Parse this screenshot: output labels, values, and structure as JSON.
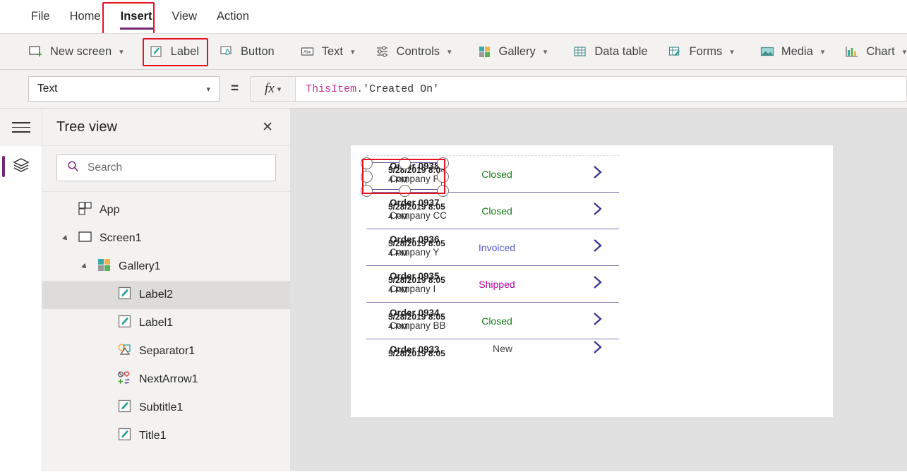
{
  "menu": {
    "items": [
      {
        "label": "File",
        "active": false
      },
      {
        "label": "Home",
        "active": false
      },
      {
        "label": "Insert",
        "active": true
      },
      {
        "label": "View",
        "active": false
      },
      {
        "label": "Action",
        "active": false
      }
    ],
    "highlight_color": "#e81123",
    "active_underline_color": "#742774"
  },
  "ribbon": {
    "items": [
      {
        "label": "New screen",
        "icon": "new-screen-icon",
        "caret": true
      },
      {
        "label": "Label",
        "icon": "label-icon",
        "caret": false
      },
      {
        "label": "Button",
        "icon": "button-icon",
        "caret": false
      },
      {
        "label": "Text",
        "icon": "text-abc-icon",
        "caret": true
      },
      {
        "label": "Controls",
        "icon": "controls-sliders-icon",
        "caret": true
      },
      {
        "label": "Gallery",
        "icon": "gallery-squares-icon",
        "caret": true
      },
      {
        "label": "Data table",
        "icon": "data-table-icon",
        "caret": false
      },
      {
        "label": "Forms",
        "icon": "forms-icon",
        "caret": true
      },
      {
        "label": "Media",
        "icon": "media-image-icon",
        "caret": true
      },
      {
        "label": "Chart",
        "icon": "chart-bars-icon",
        "caret": true
      }
    ]
  },
  "formula_bar": {
    "property": "Text",
    "equals": "=",
    "fx_label": "fx",
    "formula_tokens": [
      {
        "text": "ThisItem",
        "type": "ident"
      },
      {
        "text": ".'Created On'",
        "type": "plain"
      }
    ],
    "formula_full": "ThisItem.'Created On'"
  },
  "tree_panel": {
    "title": "Tree view",
    "close_label": "✕",
    "search_placeholder": "Search",
    "search_value": "",
    "items": [
      {
        "label": "App",
        "indent": 0,
        "icon": "app-icon",
        "twisty": "none",
        "selected": false
      },
      {
        "label": "Screen1",
        "indent": 0,
        "icon": "screen-icon",
        "twisty": "expanded",
        "selected": false
      },
      {
        "label": "Gallery1",
        "indent": 1,
        "icon": "gallery-icon",
        "twisty": "expanded",
        "selected": false
      },
      {
        "label": "Label2",
        "indent": 2,
        "icon": "label-icon",
        "twisty": "none",
        "selected": true
      },
      {
        "label": "Label1",
        "indent": 2,
        "icon": "label-icon",
        "twisty": "none",
        "selected": false
      },
      {
        "label": "Separator1",
        "indent": 2,
        "icon": "separator-icon",
        "twisty": "none",
        "selected": false
      },
      {
        "label": "NextArrow1",
        "indent": 2,
        "icon": "nextarrow-icon",
        "twisty": "none",
        "selected": false
      },
      {
        "label": "Subtitle1",
        "indent": 2,
        "icon": "label-icon",
        "twisty": "none",
        "selected": false
      },
      {
        "label": "Title1",
        "indent": 2,
        "icon": "label-icon",
        "twisty": "none",
        "selected": false
      }
    ]
  },
  "canvas": {
    "background": "#e1e1e1",
    "screen_background": "#ffffff",
    "status_colors": {
      "Closed": "#107c10",
      "Invoiced": "#5b5bd6",
      "Shipped": "#b4009e",
      "New": "#444444"
    },
    "overlap_text_line1": "5/28/2019 8:05",
    "overlap_text_line2": "4 PM",
    "gallery_items": [
      {
        "title": "Order 0938",
        "subtitle": "Company F",
        "status": "Closed",
        "selected": true,
        "arrow": "chevron-right"
      },
      {
        "title": "Order 0937",
        "subtitle": "Company CC",
        "status": "Closed",
        "selected": false,
        "arrow": "chevron-right"
      },
      {
        "title": "Order 0936",
        "subtitle": "Company Y",
        "status": "Invoiced",
        "selected": false,
        "arrow": "chevron-right"
      },
      {
        "title": "Order 0935",
        "subtitle": "Company I",
        "status": "Shipped",
        "selected": false,
        "arrow": "chevron-right"
      },
      {
        "title": "Order 0934",
        "subtitle": "Company BB",
        "status": "Closed",
        "selected": false,
        "arrow": "chevron-right"
      },
      {
        "title": "Order 0933",
        "subtitle": "",
        "status": "New",
        "selected": false,
        "arrow": "chevron-right"
      }
    ]
  }
}
